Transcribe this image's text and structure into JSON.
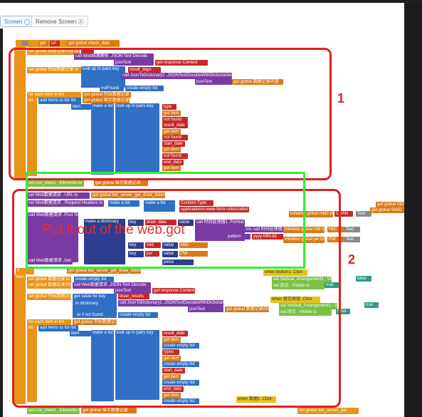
{
  "toolbar": {
    "screen_label": "Screen ◯",
    "remove_screen_label": "Remove Screen ⓧ"
  },
  "annotations": {
    "region1_number": "1",
    "region2_number": "2",
    "overlay_text": "Put it out of the web.got"
  },
  "blocks": {
    "if_get": "get",
    "if_url": "url",
    "get_check_date": "get global check_date",
    "then": "then",
    "set_global_1": "set global 数据记录内容 to",
    "empty_str": "\"\"",
    "call_web_json": "call Web结果解析 .JSON Text Decode",
    "json_text": "jsonText",
    "get_response_content": "get response Content",
    "set_global_2": "set global 列出数据记录 to",
    "look_up_pairs": "look up in pairs key",
    "result_days": "result_days",
    "pairs": "pairs",
    "call_json_dict": "call JsonToDictionary1 .JSONTextDecodeWithDictionaries",
    "get_global_1": "get global 数据记录内容",
    "notfound": "notFound",
    "create_empty_list": "create empty list",
    "for_each": "for each item in list",
    "get_global_list": "get global 列出数据记录",
    "do": "do",
    "add_items": "add items to list list",
    "get_global_show": "get global 显示数据记录",
    "item": "item",
    "make_a_list": "make a list",
    "key_type": "type",
    "get_item": "get item",
    "not_found": "not found",
    "result_date": "result_date",
    "start_date": "start_date",
    "end_date": "end_date",
    "set_listview": "set List_View1 . Elements to",
    "get_global_show2": "get global 显示数据记录",
    "set_web_url": "set Web数据请求 . URL to",
    "get_server_draw_dates": "get global bet_server_get_draw_dates",
    "set_web_headers": "set Web数据请求 . Request Headers to",
    "content_type": "Content-Type",
    "form_urlencoded": "application/x-www-form-urlencoded",
    "call_post_text": "call Web数据请求 .Post Text",
    "text": "text",
    "make_a_dictionary": "make a dictionary",
    "key": "key",
    "value": "value",
    "draw_date": "draw_date",
    "call_format_date": "call 时间处理器1 .Format Date",
    "instant": "instant",
    "call_now": "call 时间处理器1 .Now",
    "pattern": "pattern",
    "pattern_value": "yyyy-MM-dd",
    "mid": "mid",
    "get_mid": "MID",
    "pw": "pw",
    "get_pw": "PW",
    "piece": "piece",
    "call_get": "call Web数据请求 .Get",
    "initialize_mid3": "initialize global mid3 to",
    "chan": "CHAN",
    "text_label": "Text",
    "get_global_sid": "get global SID",
    "get_global_smid": "get global SMID",
    "initialize_mid": "initialize global mid to",
    "initialize_pw": "initialize global pw to",
    "get_global_mid": "MID",
    "get_global_pw": "PW",
    "when_button": "when Button1 .Click",
    "set_vert_visible": "set Vertical_Arrangement1 . Visible to",
    "false_label": "false",
    "true_label": "true",
    "set_visible": "set 提交 . Visible to",
    "when_button2": "when 提交按钮 .Click",
    "set_vert2": "set Vertical_Arrangement1 . Visible to",
    "set_visible2": "set 提交 . Visible to",
    "if2": "if",
    "get_global_draw": "get global bet_server_get_draw_dates",
    "set_global_draw": "set global 数据记录 to",
    "create_empty_list2": "create empty list",
    "call_web_json2": "call Web数据请求 .JSON Text Decode",
    "get_response2": "get response Content",
    "set_global_list2": "set global 列出数据记录 to",
    "get_value_for_key": "get value for key",
    "draw_results": "draw_results",
    "in_dictionary": "in dictionary",
    "call_json_dict2": "call JsonToDictionary1 .JSONTextDecodeWithDictionaries",
    "or_if_not_found": "or if not found",
    "for_each2": "for each item in list",
    "get_global_list2": "get global 列出数据记录",
    "types": "types",
    "when_click3": "when 数据1 .Click",
    "set_list_view2": "set List_View2 . Elements to",
    "get_global_show3": "get global 显示数据记录",
    "set_global_bet": "set global bet_server_get"
  }
}
